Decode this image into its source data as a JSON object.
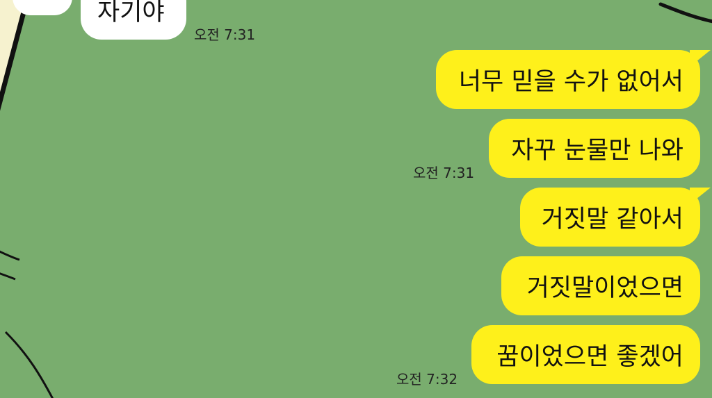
{
  "colors": {
    "background": "#79ad6e",
    "incoming_bubble": "#ffffff",
    "outgoing_bubble": "#fef01b",
    "text": "#111111"
  },
  "incoming": {
    "message": "자기야",
    "time": "오전 7:31"
  },
  "outgoing": [
    {
      "text": "너무 믿을 수가 없어서"
    },
    {
      "text": "자꾸 눈물만 나와",
      "time": "오전 7:31"
    },
    {
      "text": "거짓말 같아서"
    },
    {
      "text": "거짓말이었으면"
    },
    {
      "text": "꿈이었으면 좋겠어",
      "time": "오전 7:32"
    }
  ]
}
